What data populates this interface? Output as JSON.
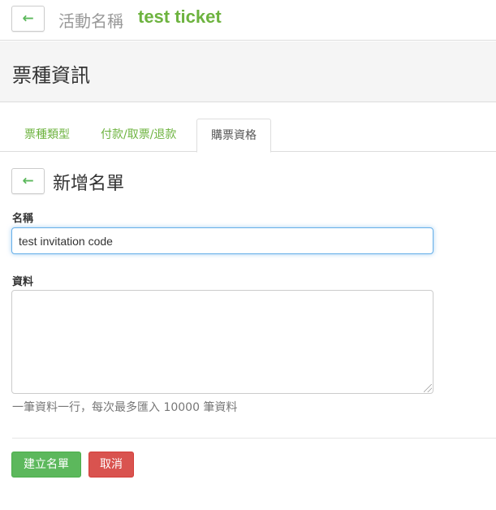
{
  "header": {
    "back_icon": "←",
    "event_label": "活動名稱",
    "event_name": "test ticket"
  },
  "section": {
    "title": "票種資訊"
  },
  "tabs": [
    {
      "label": "票種類型",
      "active": false
    },
    {
      "label": "付款/取票/退款",
      "active": false
    },
    {
      "label": "購票資格",
      "active": true
    }
  ],
  "form": {
    "back_icon": "←",
    "title": "新增名單",
    "name_label": "名稱",
    "name_value": "test invitation code",
    "data_label": "資料",
    "data_value": "",
    "help_text": "一筆資料一行，每次最多匯入 10000 筆資料"
  },
  "actions": {
    "create_label": "建立名單",
    "cancel_label": "取消"
  },
  "colors": {
    "accent_green": "#6db33f",
    "button_green": "#5cb85c",
    "button_red": "#d9534f",
    "focus_blue": "#66afe9"
  }
}
